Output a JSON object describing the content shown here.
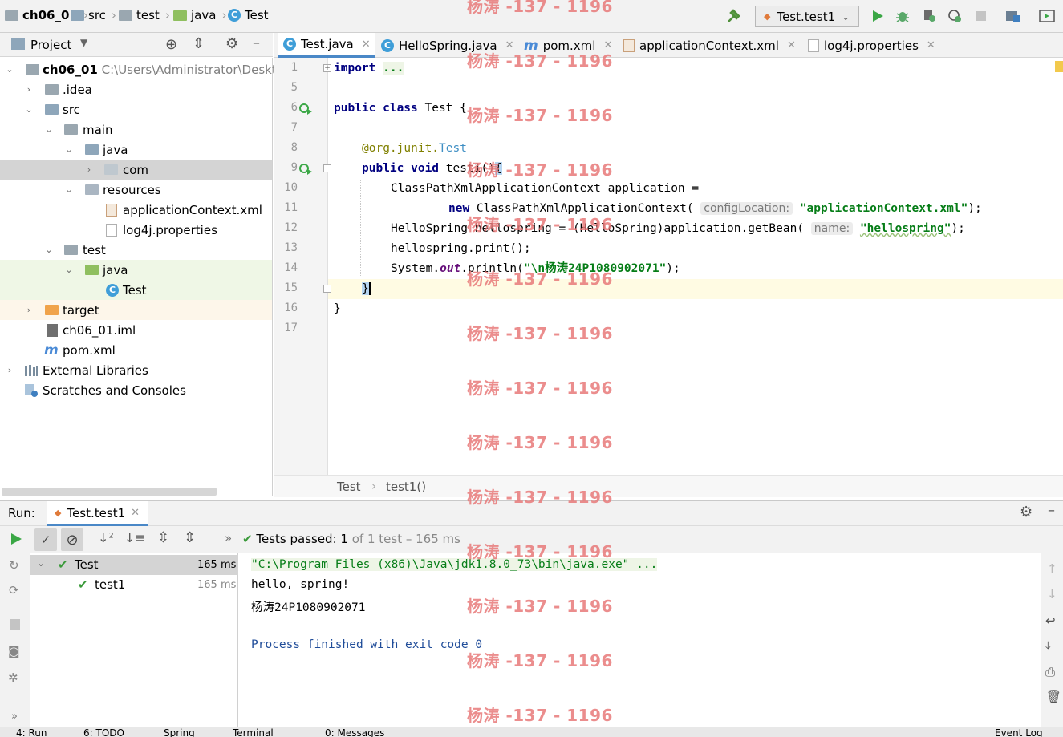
{
  "navbar": {
    "crumbs": [
      "ch06_01",
      "src",
      "test",
      "java",
      "Test"
    ],
    "run_config": "Test.test1"
  },
  "project": {
    "header": "Project",
    "tree": [
      {
        "label": "ch06_01",
        "path": "C:\\Users\\Administrator\\Deskto"
      },
      {
        "label": ".idea"
      },
      {
        "label": "src"
      },
      {
        "label": "main"
      },
      {
        "label": "java"
      },
      {
        "label": "com"
      },
      {
        "label": "resources"
      },
      {
        "label": "applicationContext.xml"
      },
      {
        "label": "log4j.properties"
      },
      {
        "label": "test"
      },
      {
        "label": "java"
      },
      {
        "label": "Test"
      },
      {
        "label": "target"
      },
      {
        "label": "ch06_01.iml"
      },
      {
        "label": "pom.xml"
      },
      {
        "label": "External Libraries"
      },
      {
        "label": "Scratches and Consoles"
      }
    ]
  },
  "tabs": [
    "Test.java",
    "HelloSpring.java",
    "pom.xml",
    "applicationContext.xml",
    "log4j.properties"
  ],
  "editor": {
    "line_numbers": [
      "1",
      "5",
      "6",
      "7",
      "8",
      "9",
      "10",
      "11",
      "12",
      "13",
      "14",
      "15",
      "16",
      "17"
    ],
    "lines": {
      "l1a": "import",
      "l1b": "...",
      "l6a": "public class",
      "l6b": " Test {",
      "l8a": "@org.junit.",
      "l8b": "Test",
      "l9a": "public void",
      "l9b": " test1()",
      "l9c": "{",
      "l10": "ClassPathXmlApplicationContext application =",
      "l11a": "new",
      "l11b": " ClassPathXmlApplicationContext(",
      "l11hint": "configLocation:",
      "l11str": "\"applicationContext.xml\"",
      "l11end": ");",
      "l12a": "HelloSpring hellospring = (HelloSpring)application.getBean(",
      "l12hint": "name:",
      "l12str": "\"hellospring\"",
      "l12end": ");",
      "l13": "hellospring.print();",
      "l14a": "System.",
      "l14b": "out",
      "l14c": ".println(",
      "l14str": "\"\\n杨涛24P1080902071\"",
      "l14end": ");",
      "l15": "}",
      "l16": "}"
    },
    "breadcrumb": [
      "Test",
      "test1()"
    ]
  },
  "run": {
    "label": "Run:",
    "tab": "Test.test1",
    "status_prefix": "Tests passed:",
    "status_count": "1",
    "status_rest": "of 1 test – 165 ms",
    "tests": [
      {
        "name": "Test",
        "time": "165 ms"
      },
      {
        "name": "test1",
        "time": "165 ms"
      }
    ],
    "console": [
      "\"C:\\Program Files (x86)\\Java\\jdk1.8.0_73\\bin\\java.exe\" ...",
      "hello, spring!",
      "杨涛24P1080902071",
      "",
      "Process finished with exit code 0"
    ]
  },
  "statusbar": [
    "4: Run",
    "6: TODO",
    "Spring",
    "Terminal",
    "0: Messages",
    "Event Log"
  ],
  "watermark": "杨涛 -137 - 1196",
  "colors": {
    "accent": "#4a88c7",
    "keyword": "#000080",
    "string": "#067d17",
    "watermark": "#e87a7a"
  }
}
